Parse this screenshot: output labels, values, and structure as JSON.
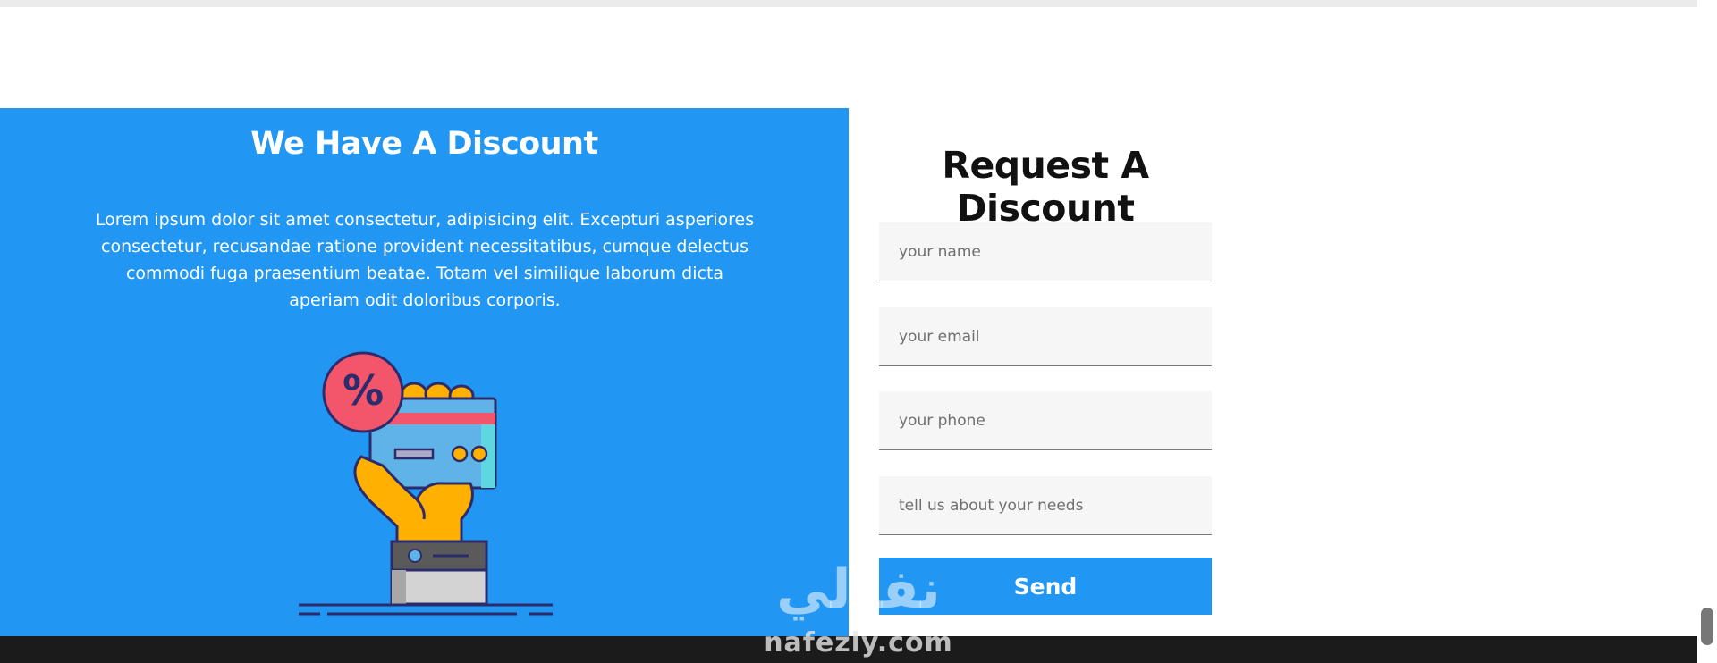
{
  "discount": {
    "title": "We Have A Discount",
    "description": "Lorem ipsum dolor sit amet consectetur, adipisicing elit. Excepturi asperiores consectetur, recusandae ratione provident necessitatibus, cumque delectus commodi fuga praesentium beatae. Totam vel similique laborum dicta aperiam odit doloribus corporis.",
    "illustration_icon": "hand-holding-discount-card-icon",
    "badge_symbol": "%"
  },
  "form": {
    "title": "Request A Discount",
    "name_placeholder": "your name",
    "email_placeholder": "your email",
    "phone_placeholder": "your phone",
    "needs_placeholder": "tell us about your needs",
    "send_label": "Send"
  },
  "watermark": {
    "arabic": "نفذلي",
    "latin": "nafezly.com"
  },
  "colors": {
    "primary": "#2196f3",
    "footer": "#1b1b1b",
    "field_background": "#f6f6f6"
  }
}
